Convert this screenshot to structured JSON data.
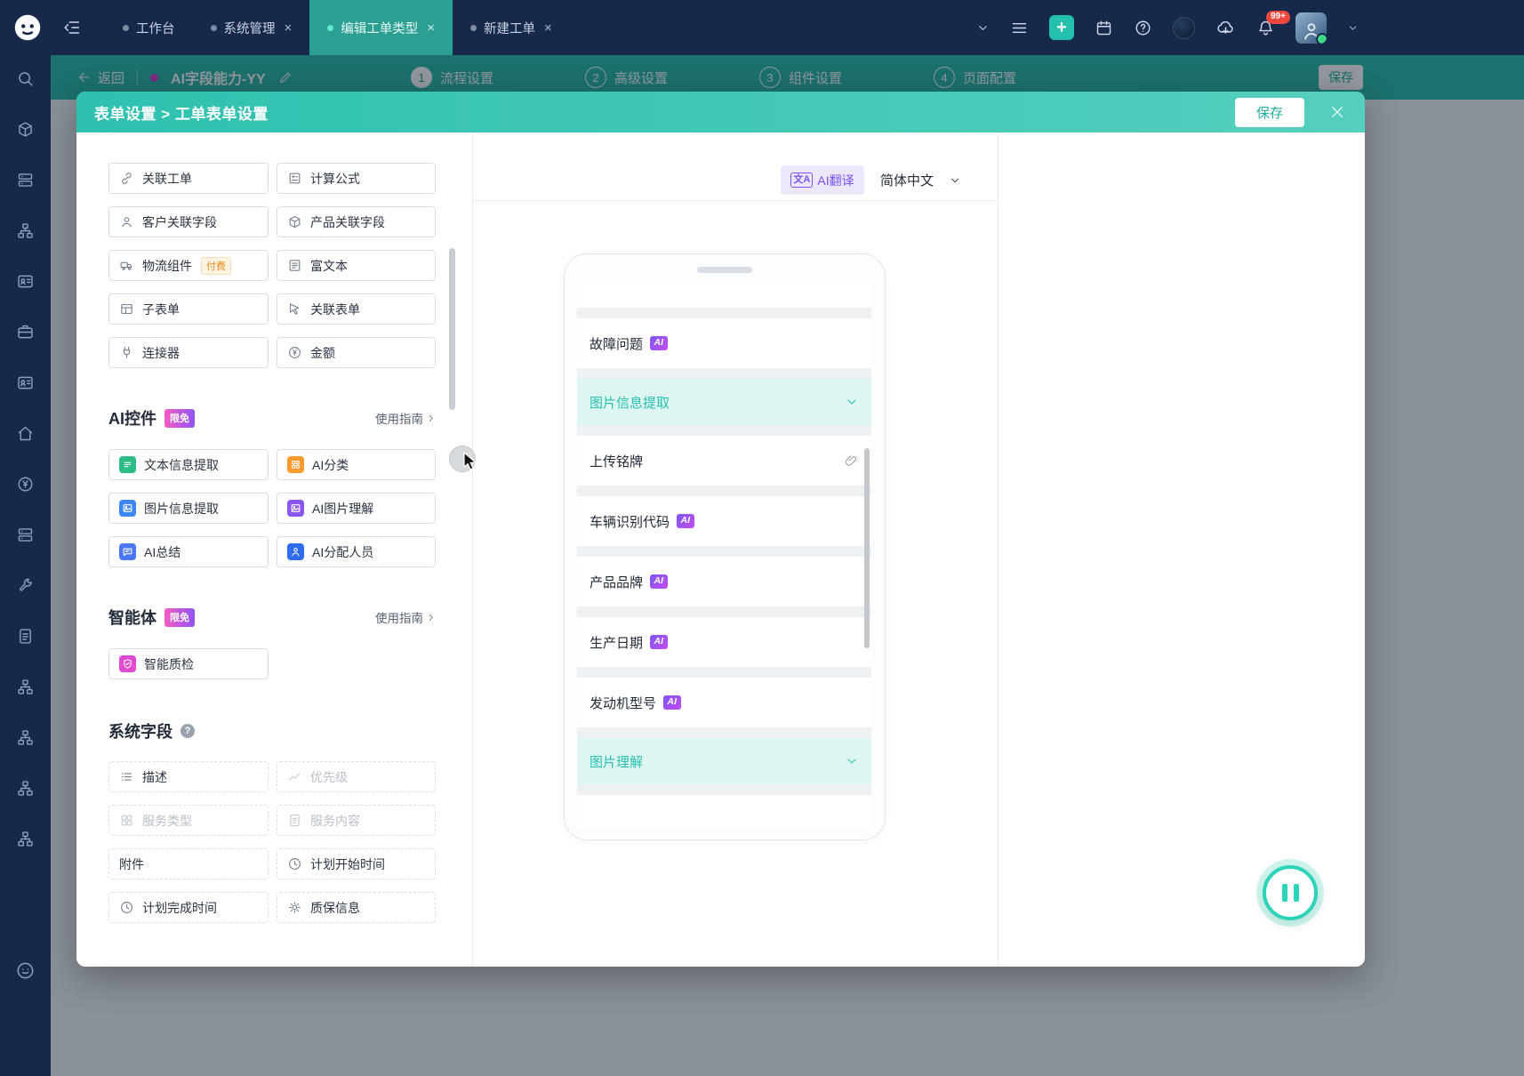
{
  "topbar": {
    "tabs": [
      {
        "label": "工作台"
      },
      {
        "label": "系统管理"
      },
      {
        "label": "编辑工单类型"
      },
      {
        "label": "新建工单"
      }
    ],
    "notification_count": "99+"
  },
  "wizard": {
    "back": "返回",
    "record_title": "AI字段能力-YY",
    "steps": [
      {
        "num": "1",
        "label": "流程设置"
      },
      {
        "num": "2",
        "label": "高级设置"
      },
      {
        "num": "3",
        "label": "组件设置"
      },
      {
        "num": "4",
        "label": "页面配置"
      }
    ],
    "save": "保存"
  },
  "modal": {
    "title": "表单设置 > 工单表单设置",
    "save": "保存",
    "palette": {
      "paid_badge": "付费",
      "fields": [
        {
          "label": "关联工单",
          "icon": "link-icon"
        },
        {
          "label": "计算公式",
          "icon": "formula-icon"
        },
        {
          "label": "客户关联字段",
          "icon": "customer-icon"
        },
        {
          "label": "产品关联字段",
          "icon": "product-box-icon"
        },
        {
          "label": "物流组件",
          "icon": "truck-icon"
        },
        {
          "label": "富文本",
          "icon": "richtext-icon"
        },
        {
          "label": "子表单",
          "icon": "subform-table-icon"
        },
        {
          "label": "关联表单",
          "icon": "pointer-icon"
        },
        {
          "label": "连接器",
          "icon": "plug-icon"
        },
        {
          "label": "金额",
          "icon": "yen-icon"
        }
      ],
      "ai": {
        "title": "AI控件",
        "badge": "限免",
        "guide": "使用指南",
        "items": [
          {
            "label": "文本信息提取",
            "icon": "text-extract-icon",
            "color": "#2ebd85"
          },
          {
            "label": "AI分类",
            "icon": "classify-icon",
            "color": "#ff9a2e"
          },
          {
            "label": "图片信息提取",
            "icon": "image-extract-icon",
            "color": "#3d87f5"
          },
          {
            "label": "AI图片理解",
            "icon": "image-understand-icon",
            "color": "#8a55f0"
          },
          {
            "label": "AI总结",
            "icon": "summary-icon",
            "color": "#4b77f6"
          },
          {
            "label": "AI分配人员",
            "icon": "assign-person-icon",
            "color": "#2e6bf0"
          }
        ]
      },
      "agent": {
        "title": "智能体",
        "badge": "限免",
        "guide": "使用指南",
        "items": [
          {
            "label": "智能质检",
            "icon": "quality-shield-icon",
            "color": "#e24ad2"
          }
        ]
      },
      "system": {
        "title": "系统字段",
        "items": [
          {
            "label": "描述",
            "icon": "list-icon",
            "disabled": false
          },
          {
            "label": "优先级",
            "icon": "trend-icon",
            "disabled": true
          },
          {
            "label": "服务类型",
            "icon": "grid-icon",
            "disabled": true
          },
          {
            "label": "服务内容",
            "icon": "doc-icon",
            "disabled": true
          },
          {
            "label": "附件",
            "icon": "",
            "disabled": false
          },
          {
            "label": "计划开始时间",
            "icon": "clock-icon",
            "disabled": false
          },
          {
            "label": "计划完成时间",
            "icon": "clock-icon",
            "disabled": false
          },
          {
            "label": "质保信息",
            "icon": "gear-icon",
            "disabled": false
          }
        ]
      }
    },
    "preview": {
      "translate": "AI翻译",
      "language": "简体中文",
      "ai_badge": "AI",
      "rows": [
        {
          "label": "故障问题",
          "type": "ai"
        },
        {
          "label": "图片信息提取",
          "type": "group"
        },
        {
          "label": "上传铭牌",
          "type": "upload"
        },
        {
          "label": "车辆识别代码",
          "type": "ai"
        },
        {
          "label": "产品品牌",
          "type": "ai"
        },
        {
          "label": "生产日期",
          "type": "ai"
        },
        {
          "label": "发动机型号",
          "type": "ai"
        },
        {
          "label": "图片理解",
          "type": "group"
        }
      ]
    }
  },
  "colors": {
    "accent_teal": "#2bbfae",
    "navy": "#16294a",
    "ai_badge_gradient": [
      "#7d55f7",
      "#c44ff0"
    ],
    "free_badge_gradient": [
      "#f65cc3",
      "#9153f5"
    ],
    "paid_orange": "#ef8c1f",
    "notification_red": "#f0483e"
  }
}
